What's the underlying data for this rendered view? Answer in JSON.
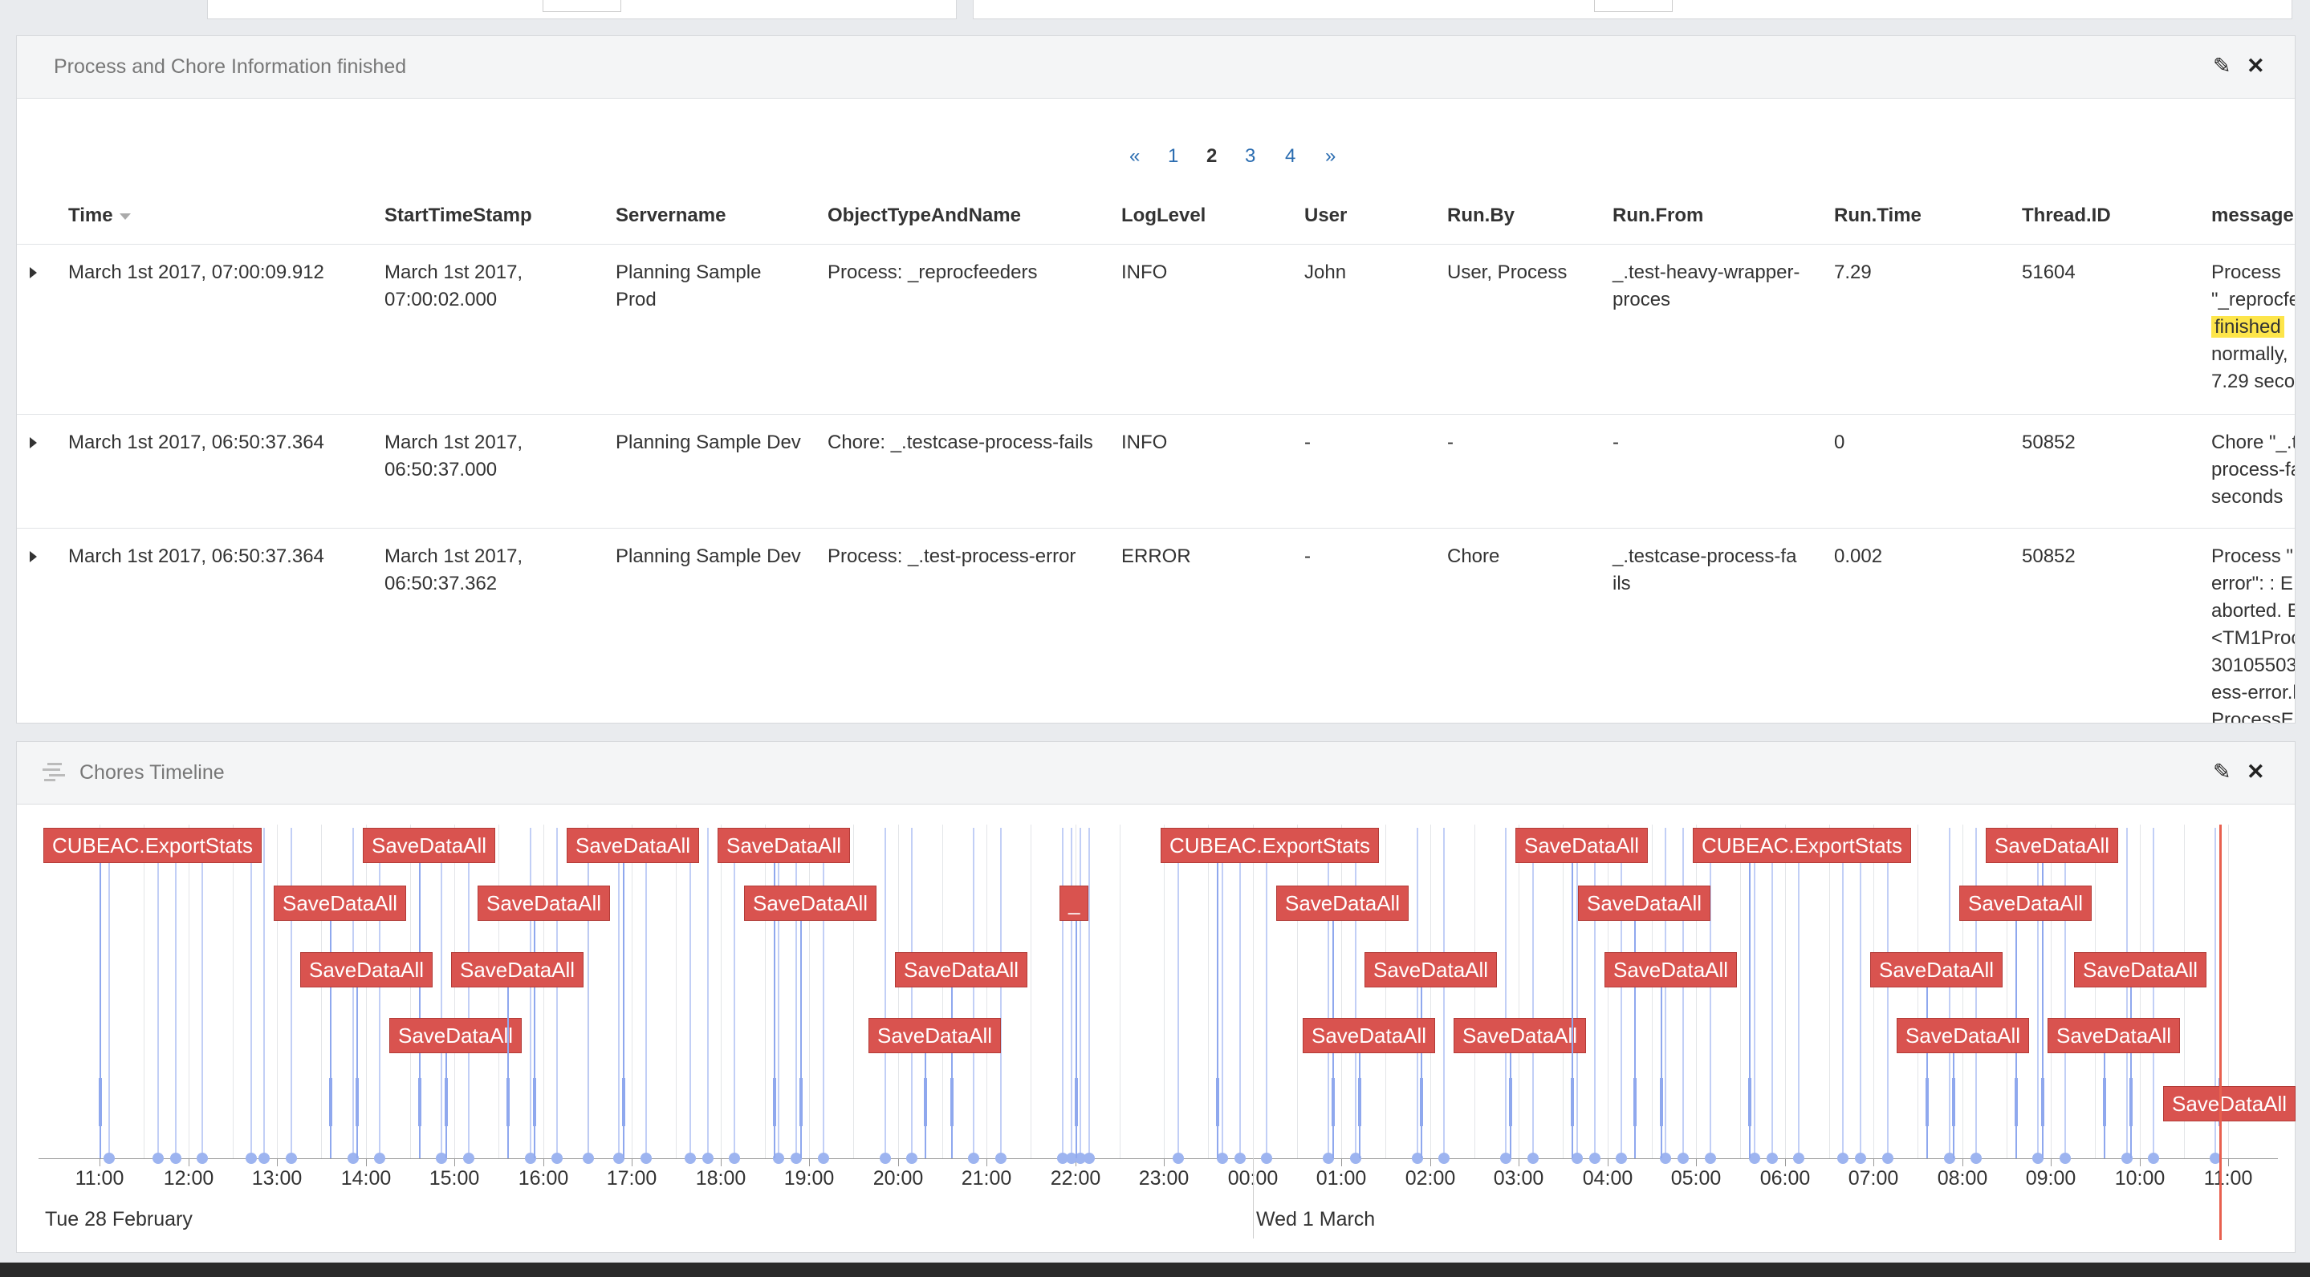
{
  "process_panel": {
    "title": "Process and Chore Information finished",
    "pagination": [
      "«",
      "1",
      "2",
      "3",
      "4",
      "»"
    ],
    "active_page": "2",
    "columns": [
      "Time",
      "StartTimeStamp",
      "Servername",
      "ObjectTypeAndName",
      "LogLevel",
      "User",
      "Run.By",
      "Run.From",
      "Run.Time",
      "Thread.ID",
      "message"
    ],
    "rows": [
      {
        "time": "March 1st 2017, 07:00:09.912",
        "start": [
          "March 1st 2017,",
          "07:00:02.000"
        ],
        "server": [
          "Planning Sample",
          "Prod"
        ],
        "object": "Process: _reprocfeeders",
        "level": "INFO",
        "user": "John",
        "runby": "User, Process",
        "runfrom": [
          "_.test-heavy-wrapper-",
          "proces"
        ],
        "runtime": "7.29",
        "thread": "51604",
        "message": [
          "Process",
          "\"_reprocfe",
          "finished",
          "normally,",
          "7.29 seco"
        ]
      },
      {
        "time": "March 1st 2017, 06:50:37.364",
        "start": [
          "March 1st 2017,",
          "06:50:37.000"
        ],
        "server": [
          "Planning Sample Dev"
        ],
        "object": "Chore: _.testcase-process-fails",
        "level": "INFO",
        "user": "-",
        "runby": "-",
        "runfrom": [
          "-"
        ],
        "runtime": "0",
        "thread": "50852",
        "message": [
          "Chore \"_.t",
          "process-fa",
          "seconds"
        ]
      },
      {
        "time": "March 1st 2017, 06:50:37.364",
        "start": [
          "March 1st 2017,",
          "06:50:37.362"
        ],
        "server": [
          "Planning Sample Dev"
        ],
        "object": "Process: _.test-process-error",
        "level": "ERROR",
        "user": "-",
        "runby": "Chore",
        "runfrom": [
          "_.testcase-process-fa",
          "ils"
        ],
        "runtime": "0.002",
        "thread": "50852",
        "message": [
          "Process \"",
          "error\": : E",
          "aborted. E",
          "<TM1Proc",
          "30105503",
          "ess-error.l",
          "ProcessE"
        ]
      }
    ]
  },
  "timeline_panel": {
    "title": "Chores Timeline",
    "hour_ticks": [
      "11:00",
      "12:00",
      "13:00",
      "14:00",
      "15:00",
      "16:00",
      "17:00",
      "18:00",
      "19:00",
      "20:00",
      "21:00",
      "22:00",
      "23:00",
      "00:00",
      "01:00",
      "02:00",
      "03:00",
      "04:00",
      "05:00",
      "06:00",
      "07:00",
      "08:00",
      "09:00",
      "10:00",
      "11:00"
    ],
    "dates": [
      "Tue 28 February",
      "Wed 1 March"
    ],
    "events": [
      {
        "label": "CUBEAC.ExportStats",
        "time_h": 11.0,
        "lane": 1
      },
      {
        "label": "SaveDataAll",
        "time_h": 14.6,
        "lane": 1
      },
      {
        "label": "SaveDataAll",
        "time_h": 13.6,
        "lane": 2
      },
      {
        "label": "SaveDataAll",
        "time_h": 13.9,
        "lane": 3
      },
      {
        "label": "SaveDataAll",
        "time_h": 14.9,
        "lane": 4
      },
      {
        "label": "SaveDataAll",
        "time_h": 16.9,
        "lane": 1
      },
      {
        "label": "SaveDataAll",
        "time_h": 15.9,
        "lane": 2
      },
      {
        "label": "SaveDataAll",
        "time_h": 15.6,
        "lane": 3
      },
      {
        "label": "SaveDataAll",
        "time_h": 18.6,
        "lane": 1
      },
      {
        "label": "SaveDataAll",
        "time_h": 18.9,
        "lane": 2
      },
      {
        "label": "_",
        "time_h": 22.0,
        "lane": 2
      },
      {
        "label": "SaveDataAll",
        "time_h": 20.6,
        "lane": 3
      },
      {
        "label": "SaveDataAll",
        "time_h": 20.3,
        "lane": 4
      },
      {
        "label": "CUBEAC.ExportStats",
        "time_h": 23.6,
        "lane": 1
      },
      {
        "label": "SaveDataAll",
        "time_h": 24.9,
        "lane": 2
      },
      {
        "label": "SaveDataAll",
        "time_h": 25.9,
        "lane": 3
      },
      {
        "label": "SaveDataAll",
        "time_h": 25.2,
        "lane": 4
      },
      {
        "label": "SaveDataAll",
        "time_h": 26.9,
        "lane": 4
      },
      {
        "label": "SaveDataAll",
        "time_h": 27.6,
        "lane": 1
      },
      {
        "label": "SaveDataAll",
        "time_h": 28.3,
        "lane": 2
      },
      {
        "label": "SaveDataAll",
        "time_h": 28.6,
        "lane": 3
      },
      {
        "label": "CUBEAC.ExportStats",
        "time_h": 29.6,
        "lane": 1
      },
      {
        "label": "SaveDataAll",
        "time_h": 32.9,
        "lane": 1
      },
      {
        "label": "SaveDataAll",
        "time_h": 32.6,
        "lane": 2
      },
      {
        "label": "SaveDataAll",
        "time_h": 31.6,
        "lane": 3
      },
      {
        "label": "SaveDataAll",
        "time_h": 31.9,
        "lane": 4
      },
      {
        "label": "SaveDataAll",
        "time_h": 33.9,
        "lane": 3
      },
      {
        "label": "SaveDataAll",
        "time_h": 33.6,
        "lane": 4
      },
      {
        "label": "SaveDataAll",
        "time_h": 34.9,
        "lane": 5
      }
    ],
    "current_time_h": 34.9
  }
}
